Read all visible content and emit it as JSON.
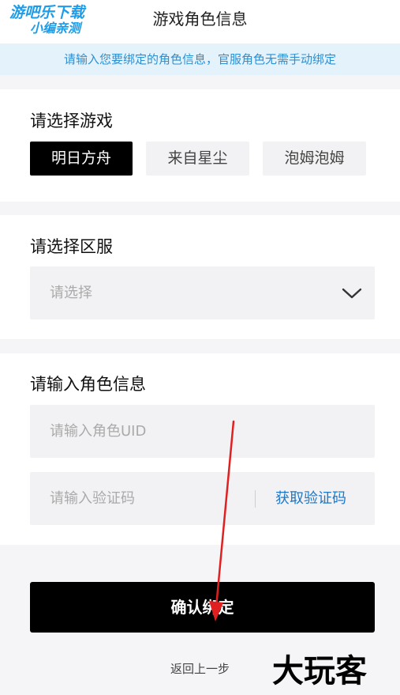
{
  "header": {
    "title": "游戏角色信息",
    "watermark_line1": "游吧乐下载",
    "watermark_line2": "小编亲测"
  },
  "notice": "请输入您要绑定的角色信息，官服角色无需手动绑定",
  "game_section": {
    "title": "请选择游戏",
    "games": [
      {
        "label": "明日方舟",
        "selected": true
      },
      {
        "label": "来自星尘",
        "selected": false
      },
      {
        "label": "泡姆泡姆",
        "selected": false
      }
    ]
  },
  "server_section": {
    "title": "请选择区服",
    "select_placeholder": "请选择"
  },
  "role_section": {
    "title": "请输入角色信息",
    "uid_placeholder": "请输入角色UID",
    "code_placeholder": "请输入验证码",
    "get_code_label": "获取验证码"
  },
  "actions": {
    "confirm_label": "确认绑定",
    "back_label": "返回上一步"
  },
  "watermark_bottom": "大玩客",
  "colors": {
    "accent_blue": "#2e8fd1",
    "notice_bg": "#e3f2fb",
    "primary_button": "#000000",
    "annotation_arrow": "#e02020"
  }
}
